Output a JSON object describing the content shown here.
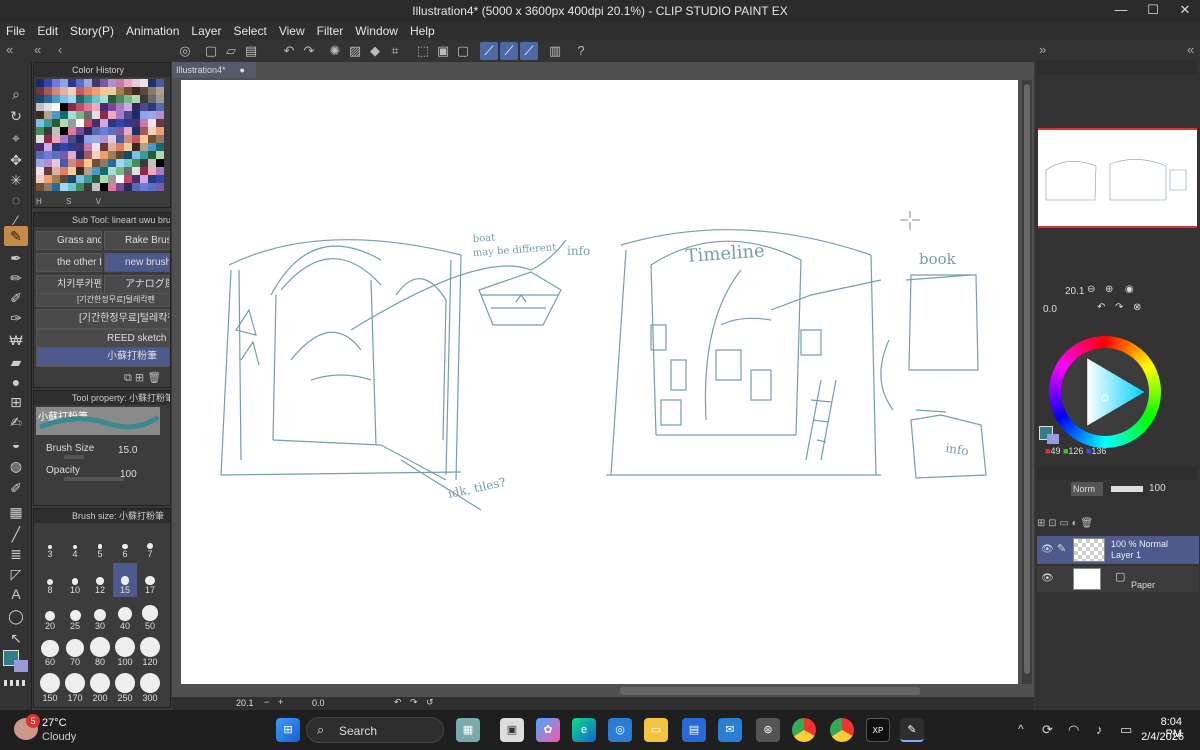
{
  "window": {
    "title": "Illustration4* (5000 x 3600px 400dpi 20.1%)  - CLIP STUDIO PAINT EX",
    "minimize": "—",
    "maximize": "☐",
    "close": "✕"
  },
  "menu": [
    "File",
    "Edit",
    "Story(P)",
    "Animation",
    "Layer",
    "Select",
    "View",
    "Filter",
    "Window",
    "Help"
  ],
  "document_tab": {
    "label": "Illustration4*"
  },
  "color_history": {
    "title": "Color History",
    "colors": [
      "#1b2a6b",
      "#3344aa",
      "#6b7dd9",
      "#8fa4e8",
      "#2e3a8c",
      "#5a6fc8",
      "#9aa8e0",
      "#44356e",
      "#7a5aa0",
      "#b48fd0",
      "#c87aa8",
      "#e8a6c6",
      "#e6c8d6",
      "#f0e0e8",
      "#203060",
      "#4a5aa0",
      "#6a3a3a",
      "#a05a5a",
      "#d08a7a",
      "#e0b0a0",
      "#f0d0c0",
      "#c85a5a",
      "#e08060",
      "#f0a070",
      "#f8c890",
      "#e8d0a0",
      "#a08050",
      "#705030",
      "#3a2a20",
      "#5a4a3a",
      "#8a7a6a",
      "#b0a090",
      "#1a4a6a",
      "#2a6a9a",
      "#4a9ac8",
      "#7ac0e0",
      "#a0d8f0",
      "#1a6a6a",
      "#3a9a9a",
      "#6ac8c8",
      "#a0e0d8",
      "#2a5a3a",
      "#4a8a5a",
      "#7ab88a",
      "#b0d8b0",
      "#3a3a3a",
      "#6a6a6a",
      "#9a9a9a",
      "#c0c0c0",
      "#e0e0e0",
      "#ffffff",
      "#000000",
      "#8a2a4a",
      "#c04a6a",
      "#e07a9a",
      "#f0a8c0",
      "#4a2a6a",
      "#7a4a9a",
      "#a87ac8",
      "#d0a8e8",
      "#2a2a5a",
      "#4a4a8a",
      "#2a3a7a",
      "#5a6ab0"
    ],
    "footer": [
      "H",
      "S",
      "V"
    ]
  },
  "subtool": {
    "title": "Sub Tool: lineart uwu brush",
    "brushes": [
      {
        "label": "Grass and"
      },
      {
        "label": "Rake Brus"
      },
      {
        "label": "the other fo"
      },
      {
        "label": "new brush"
      },
      {
        "label": "치키루카펜"
      },
      {
        "label": "アナログ風..."
      },
      {
        "label": "[기간한정무료]털레칵펜"
      },
      {
        "label": "[기간한정무료]털레칵펜"
      },
      {
        "label": "REED sketch"
      },
      {
        "label": "小蘇打粉筆"
      }
    ]
  },
  "tool_property": {
    "title": "Tool property: 小蘇打粉筆",
    "brush_name": "小蘇打粉筆",
    "brush_size_label": "Brush Size",
    "brush_size_value": "15.0",
    "opacity_label": "Opacity",
    "opacity_value": "100"
  },
  "brush_size_panel": {
    "title": "Brush size: 小蘇打粉筆",
    "sizes": [
      "3",
      "4",
      "5",
      "6",
      "7",
      "8",
      "10",
      "12",
      "15",
      "17",
      "20",
      "25",
      "30",
      "40",
      "50",
      "60",
      "70",
      "80",
      "100",
      "120",
      "150",
      "170",
      "200",
      "250",
      "300"
    ],
    "selected": "15"
  },
  "canvas": {
    "annotations": [
      "boat",
      "may be different",
      "info",
      "Timeline",
      "book",
      "idk, tiles?",
      "info"
    ]
  },
  "status": {
    "zoom": "20.1",
    "angle": "0.0"
  },
  "navigator": {
    "zoom": "20.1",
    "angle": "0.0"
  },
  "color_wheel": {
    "r": "49",
    "g": "126",
    "b": "136",
    "main_color": "#317e88",
    "sub_color": "#9a9adb"
  },
  "layers": {
    "blend_mode": "Norm",
    "opacity": "100",
    "items": [
      {
        "meta": "100 % Normal",
        "name": "Layer 1"
      },
      {
        "meta": "",
        "name": "Paper"
      }
    ]
  },
  "taskbar": {
    "weather_temp": "27°C",
    "weather_desc": "Cloudy",
    "notification_count": "5",
    "search_placeholder": "Search",
    "time": "8:04 PM",
    "date": "2/4/2026"
  }
}
